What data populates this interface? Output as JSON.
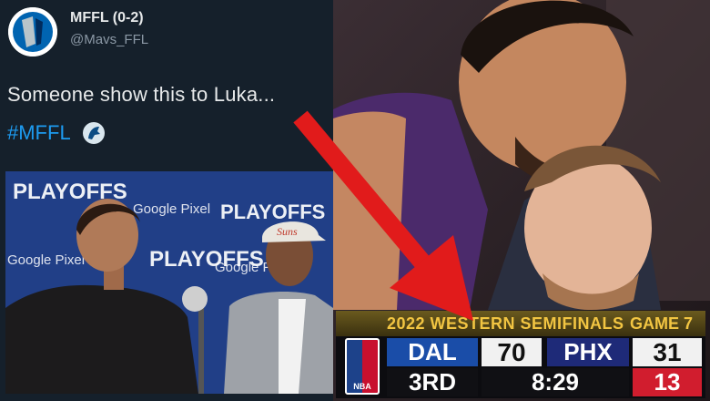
{
  "tweet": {
    "display_name": "MFFL (0-2)",
    "handle": "@Mavs_FFL",
    "text": "Someone show this to Luka...",
    "hashtag": "#MFFL",
    "avatar_icon": "mavericks-logo-icon",
    "emoji_icon": "mavericks-horse-icon"
  },
  "press_photo": {
    "backdrop_text": [
      "PLAYOFFS",
      "Google Pixel"
    ],
    "cap_text": "Suns"
  },
  "scoreboard": {
    "round": "2022 WESTERN SEMIFINALS",
    "game": "GAME 7",
    "league_logo": "NBA",
    "away_team": "DAL",
    "away_score": "70",
    "home_team": "PHX",
    "home_score": "31",
    "period": "3RD",
    "clock": "8:29",
    "shot_clock": "13"
  },
  "colors": {
    "twitter_bg": "#15202b",
    "hashtag": "#1d9bf0",
    "arrow": "#e11b1b",
    "dal_blue": "#1a4da8",
    "shot_clock_red": "#d11d2e",
    "header_gold": "#f2c542"
  }
}
